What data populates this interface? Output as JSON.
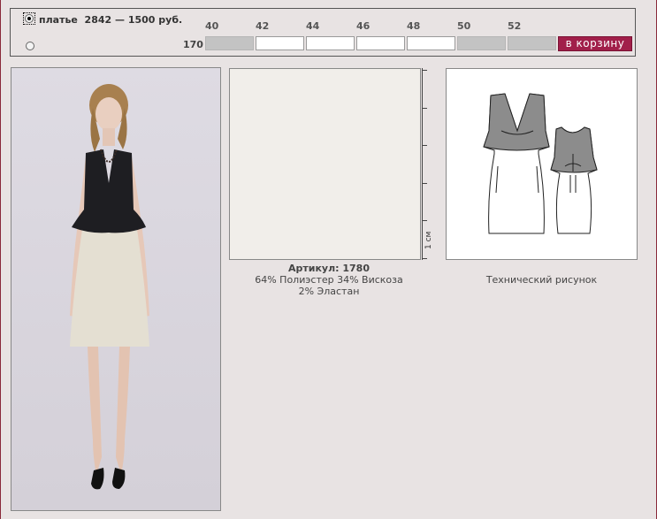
{
  "product": {
    "name": "платье",
    "code": "2842",
    "price": "1500 руб."
  },
  "sizes": [
    "40",
    "42",
    "44",
    "46",
    "48",
    "50",
    "52"
  ],
  "height": "170",
  "size_availability": [
    false,
    true,
    true,
    true,
    true,
    false,
    false
  ],
  "cart_button": "в корзину",
  "fabric": {
    "article_label": "Артикул: 1780",
    "composition_line1": "64% Полиэстер 34% Вискоза",
    "composition_line2": "2% Эластан",
    "scale_label": "1 см"
  },
  "tech_drawing_caption": "Технический рисунок",
  "colors": {
    "accent": "#a11f4a",
    "page_bg": "#e8e3e3",
    "unavailable_cell": "#c3c3c3"
  }
}
